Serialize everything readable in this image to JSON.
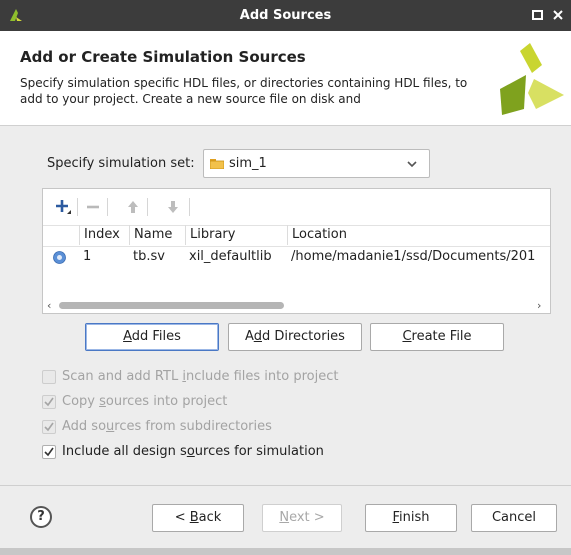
{
  "window": {
    "title": "Add Sources",
    "icons": {
      "app": "vivado-logo-icon",
      "maximize": "maximize-icon",
      "close": "close-icon"
    }
  },
  "header": {
    "heading": "Add or Create Simulation Sources",
    "description": "Specify simulation specific HDL files, or directories containing HDL files, to add to your project. Create a new source file on disk and",
    "logo": "xilinx-logo"
  },
  "simset": {
    "label": "Specify simulation set:",
    "value": "sim_1"
  },
  "toolbar": {
    "icons": [
      "add-icon",
      "remove-icon",
      "move-up-icon",
      "move-down-icon"
    ]
  },
  "table": {
    "columns": [
      "Index",
      "Name",
      "Library",
      "Location"
    ],
    "rows": [
      {
        "icon": "source-file-icon",
        "index": "1",
        "name": "tb.sv",
        "library": "xil_defaultlib",
        "location": "/home/madanie1/ssd/Documents/201"
      }
    ]
  },
  "buttons": {
    "add_files": {
      "pre": "",
      "key": "A",
      "post": "dd Files"
    },
    "add_directories": {
      "pre": "A",
      "key": "d",
      "post": "d Directories"
    },
    "create_file": {
      "pre": "",
      "key": "C",
      "post": "reate File"
    }
  },
  "options": [
    {
      "pre": "Scan and add RTL ",
      "key": "i",
      "post": "nclude files into project",
      "checked": false,
      "enabled": false
    },
    {
      "pre": "Copy ",
      "key": "s",
      "post": "ources into project",
      "checked": true,
      "enabled": false
    },
    {
      "pre": "Add so",
      "key": "u",
      "post": "rces from subdirectories",
      "checked": true,
      "enabled": false
    },
    {
      "pre": "Include all design s",
      "key": "o",
      "post": "urces for simulation",
      "checked": true,
      "enabled": true
    }
  ],
  "footer": {
    "help": "?",
    "back": {
      "pre": "< ",
      "key": "B",
      "post": "ack"
    },
    "next": {
      "pre": "",
      "key": "N",
      "post": "ext >"
    },
    "finish": {
      "pre": "",
      "key": "F",
      "post": "inish"
    },
    "cancel": "Cancel"
  },
  "colors": {
    "accent": "#4a78c5",
    "titlebar": "#3c3c3c",
    "logo_yellow": "#c5d02a",
    "logo_green": "#7fa21e"
  }
}
